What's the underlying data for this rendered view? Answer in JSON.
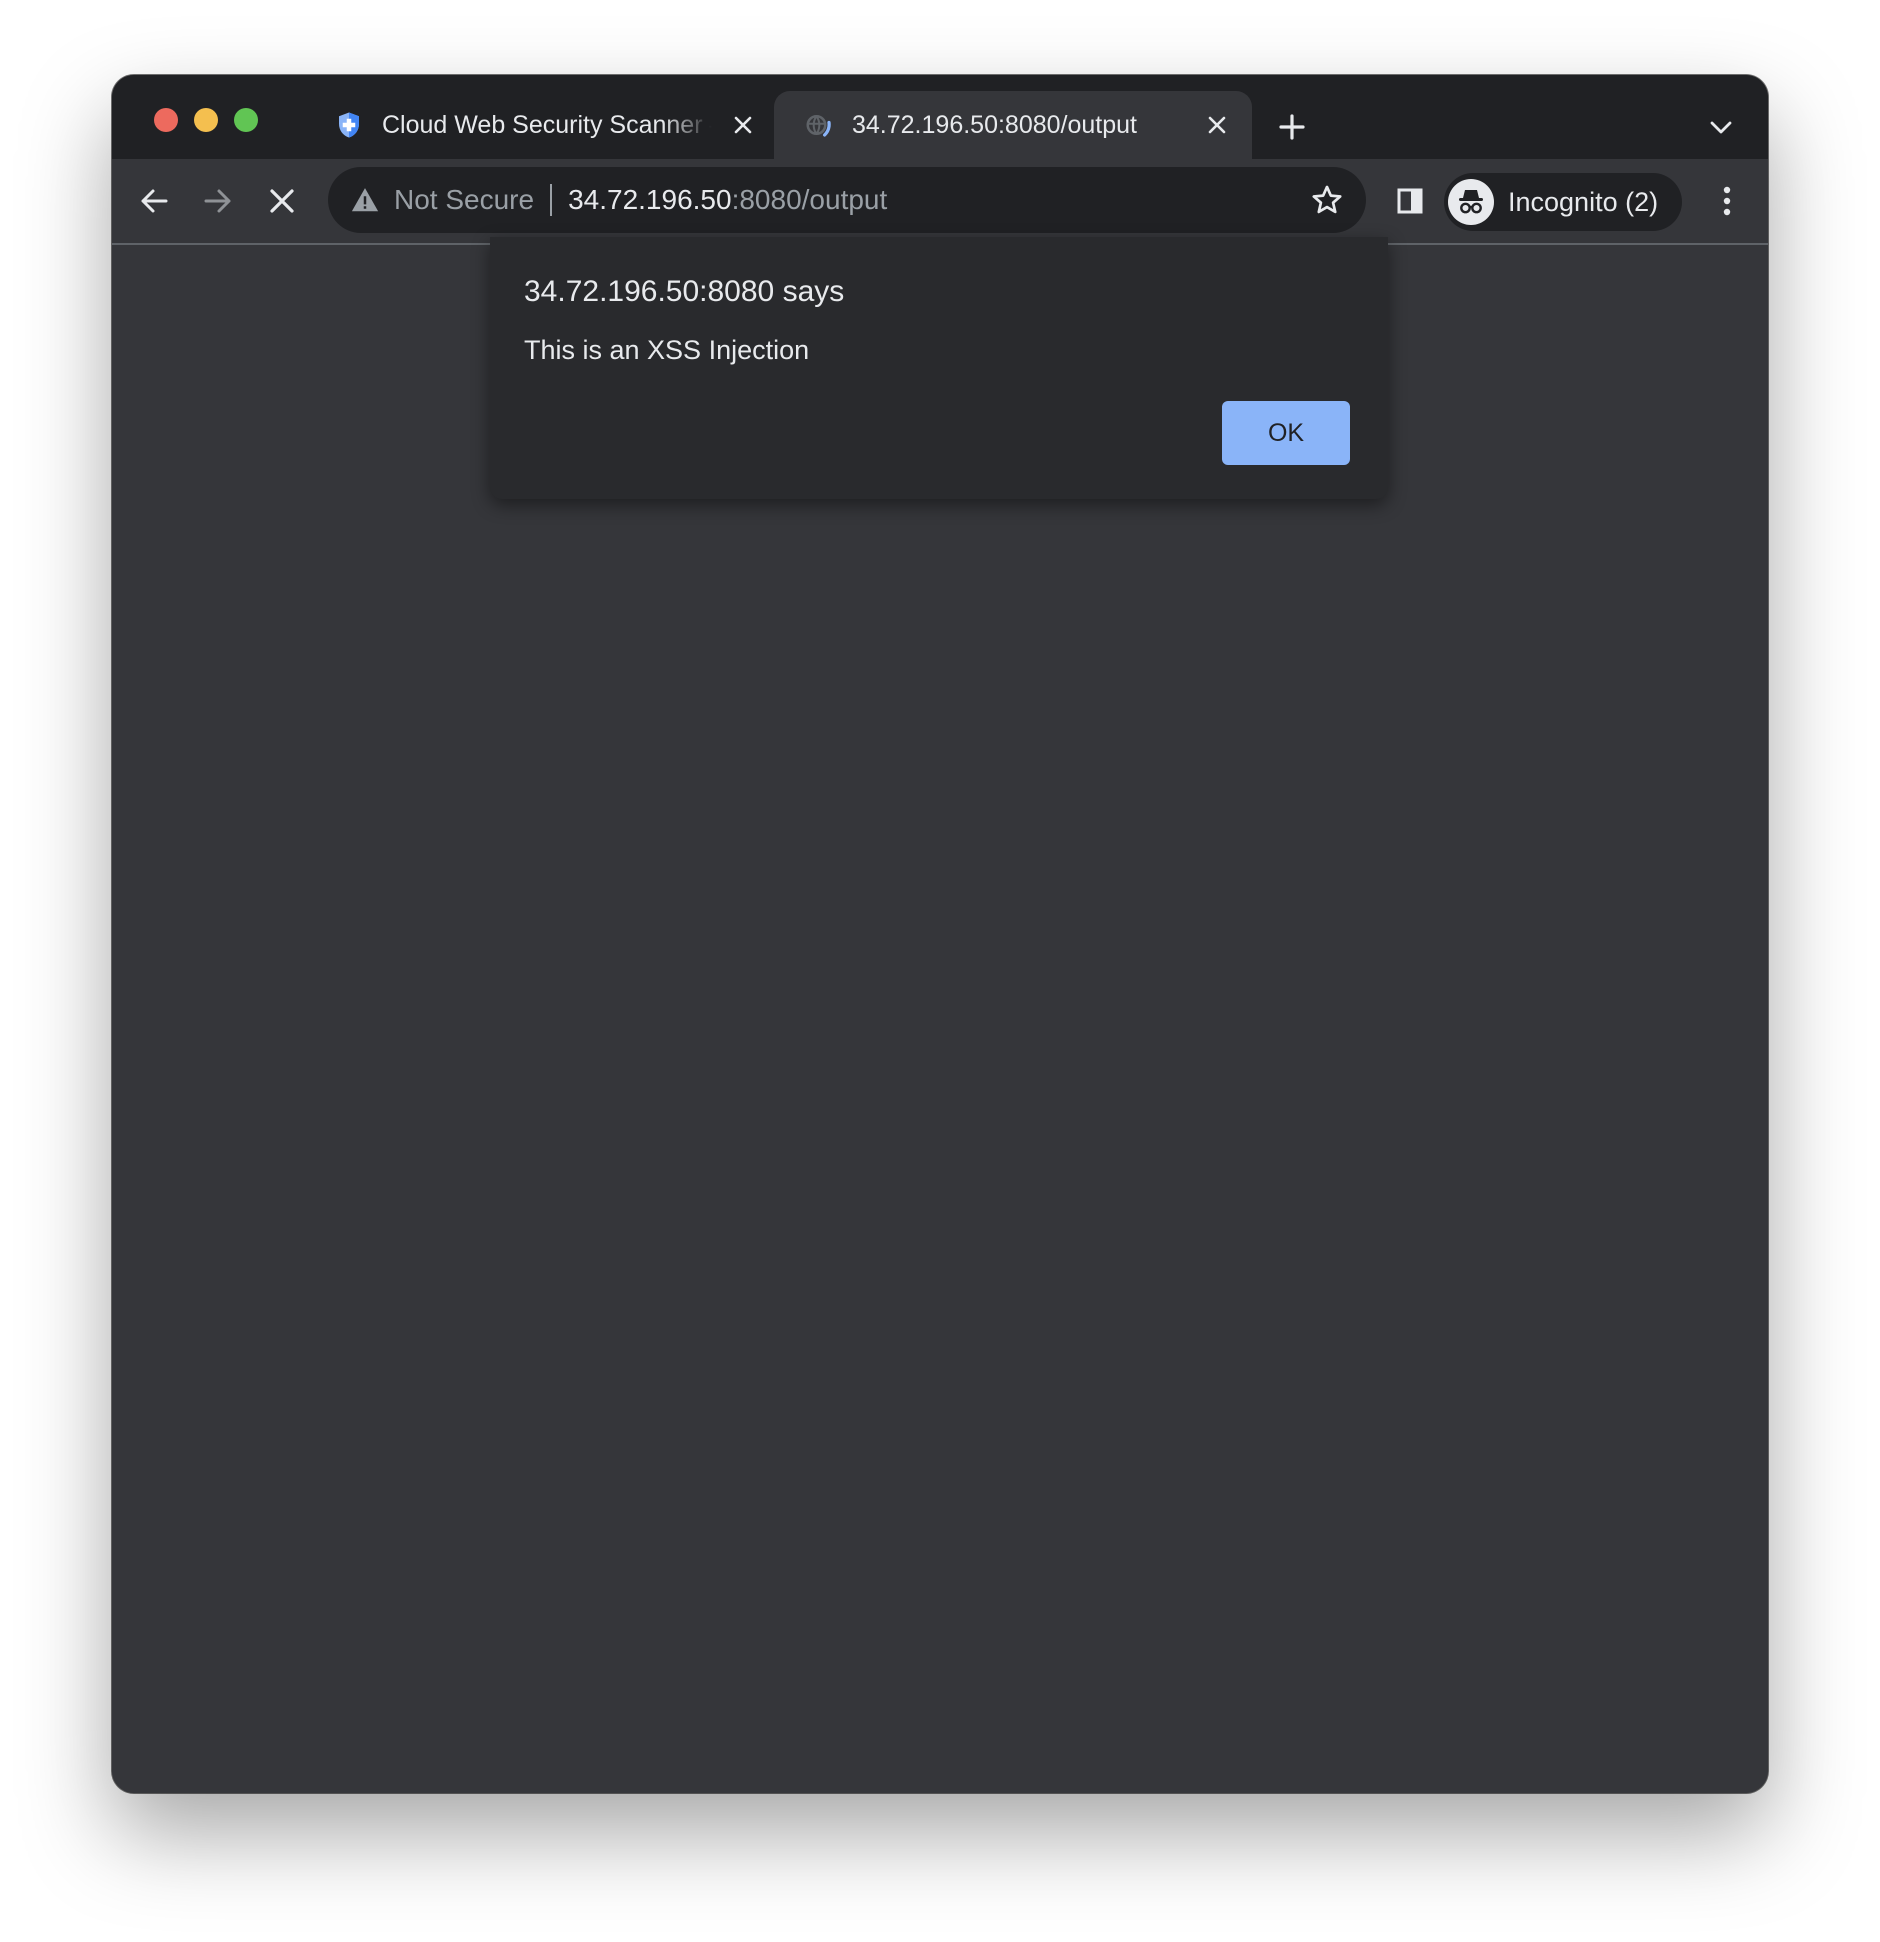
{
  "tabs": [
    {
      "title": "Cloud Web Security Scanner – Web Security Scanner – Google Cloud",
      "icon": "shield-icon",
      "active": false
    },
    {
      "title": "34.72.196.50:8080/output",
      "icon": "loading-globe-icon",
      "active": true
    }
  ],
  "address_bar": {
    "security_label": "Not Secure",
    "url_host": "34.72.196.50",
    "url_rest": ":8080/output"
  },
  "profile": {
    "label": "Incognito (2)"
  },
  "dialog": {
    "heading": "34.72.196.50:8080 says",
    "message": "This is an XSS Injection",
    "ok_label": "OK"
  },
  "colors": {
    "tabstrip": "#202124",
    "toolbar": "#35363a",
    "dialog_bg": "#292a2d",
    "accent": "#8ab4f8",
    "text": "#e8eaed",
    "muted_text": "#9aa0a6"
  }
}
